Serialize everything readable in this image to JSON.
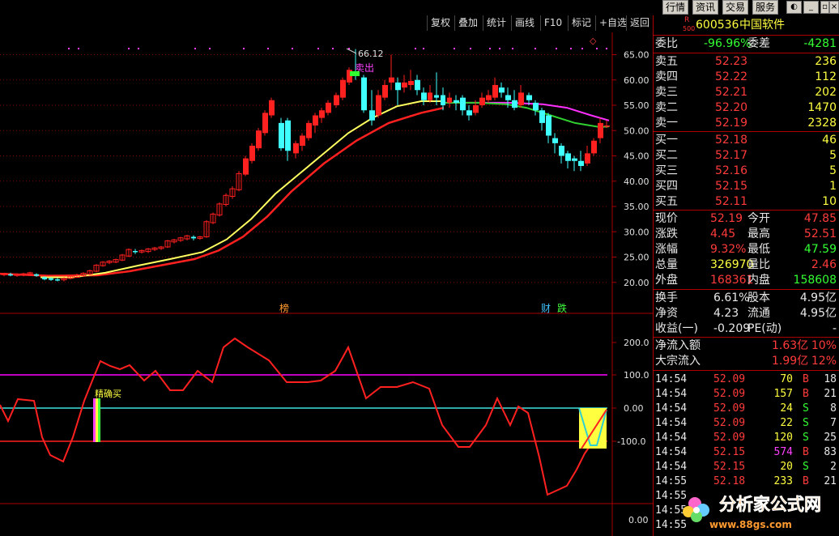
{
  "system_menu": [
    "行情",
    "资讯",
    "交易",
    "服务"
  ],
  "toolbar": [
    "复权",
    "叠加",
    "统计",
    "画线",
    "F10",
    "标记",
    "+自选",
    "返回"
  ],
  "stock": {
    "badge_top": "R",
    "badge_bottom": "500",
    "code": "600536",
    "name": "中国软件"
  },
  "weibi": {
    "label1": "委比",
    "value1": "-96.96%",
    "label2": "委差",
    "value2": "-4281"
  },
  "asks": [
    {
      "label": "卖五",
      "price": "52.23",
      "vol": "236"
    },
    {
      "label": "卖四",
      "price": "52.22",
      "vol": "112"
    },
    {
      "label": "卖三",
      "price": "52.21",
      "vol": "202"
    },
    {
      "label": "卖二",
      "price": "52.20",
      "vol": "1470"
    },
    {
      "label": "卖一",
      "price": "52.19",
      "vol": "2328"
    }
  ],
  "bids": [
    {
      "label": "买一",
      "price": "52.18",
      "vol": "46"
    },
    {
      "label": "买二",
      "price": "52.17",
      "vol": "5"
    },
    {
      "label": "买三",
      "price": "52.16",
      "vol": "5"
    },
    {
      "label": "买四",
      "price": "52.15",
      "vol": "1"
    },
    {
      "label": "买五",
      "price": "52.11",
      "vol": "10"
    }
  ],
  "stats": [
    {
      "l1": "现价",
      "v1": "52.19",
      "c1": "red",
      "l2": "今开",
      "v2": "47.85",
      "c2": "red"
    },
    {
      "l1": "涨跌",
      "v1": "4.45",
      "c1": "red",
      "l2": "最高",
      "v2": "52.51",
      "c2": "red"
    },
    {
      "l1": "涨幅",
      "v1": "9.32%",
      "c1": "red",
      "l2": "最低",
      "v2": "47.59",
      "c2": "grn"
    },
    {
      "l1": "总量",
      "v1": "326970",
      "c1": "yel",
      "l2": "量比",
      "v2": "2.46",
      "c2": "red"
    },
    {
      "l1": "外盘",
      "v1": "168361",
      "c1": "red",
      "l2": "内盘",
      "v2": "158608",
      "c2": "grn"
    }
  ],
  "stats2": [
    {
      "l1": "换手",
      "v1": "6.61%",
      "l2": "股本",
      "v2": "4.95亿"
    },
    {
      "l1": "净资",
      "v1": "4.23",
      "l2": "流通",
      "v2": "4.95亿"
    },
    {
      "l1": "收益(一)",
      "v1": "-0.209",
      "l2": "PE(动)",
      "v2": "-"
    }
  ],
  "flows": [
    {
      "label": "净流入额",
      "value": "1.63亿",
      "pct": "10%"
    },
    {
      "label": "大宗流入",
      "value": "1.99亿",
      "pct": "12%"
    }
  ],
  "ticks": [
    {
      "time": "14:54",
      "price": "52.09",
      "vol": "70",
      "side": "B",
      "n": "18"
    },
    {
      "time": "14:54",
      "price": "52.09",
      "vol": "157",
      "side": "B",
      "n": "21"
    },
    {
      "time": "14:54",
      "price": "52.09",
      "vol": "24",
      "side": "S",
      "n": "8"
    },
    {
      "time": "14:54",
      "price": "52.09",
      "vol": "22",
      "side": "S",
      "n": "7"
    },
    {
      "time": "14:54",
      "price": "52.09",
      "vol": "120",
      "side": "S",
      "n": "25"
    },
    {
      "time": "14:54",
      "price": "52.15",
      "vol": "574",
      "side": "B",
      "n": "83"
    },
    {
      "time": "14:54",
      "price": "52.15",
      "vol": "20",
      "side": "S",
      "n": "2"
    },
    {
      "time": "14:55",
      "price": "52.18",
      "vol": "233",
      "side": "B",
      "n": "21"
    },
    {
      "time": "14:55",
      "price": "",
      "vol": "",
      "side": "",
      "n": ""
    },
    {
      "time": "14:55",
      "price": "",
      "vol": "",
      "side": "",
      "n": ""
    },
    {
      "time": "14:55",
      "price": "",
      "vol": "",
      "side": "",
      "n": ""
    }
  ],
  "chart_labels": {
    "peak": "66.12",
    "sell": "卖出",
    "buy": "精确买",
    "m1": "榜",
    "m2": "财",
    "m3": "跌"
  },
  "price_axis": [
    "65.00",
    "60.00",
    "55.00",
    "50.00",
    "45.00",
    "40.00",
    "35.00",
    "30.00",
    "25.00",
    "20.00"
  ],
  "ind_axis": [
    "200.0",
    "100.0",
    "0.00",
    "-100.0"
  ],
  "vol_axis": [
    "0.00"
  ],
  "watermark": {
    "brand": "分析家公式网",
    "url": "www.88gs.com"
  },
  "colors": {
    "up": "#ff2020",
    "down": "#40ffff",
    "ma_short": "#ffff60",
    "ma_long": "#ff2020",
    "ind_line": "#ff2020",
    "hundred": "#ff00ff",
    "zero": "#40e0e0"
  }
}
